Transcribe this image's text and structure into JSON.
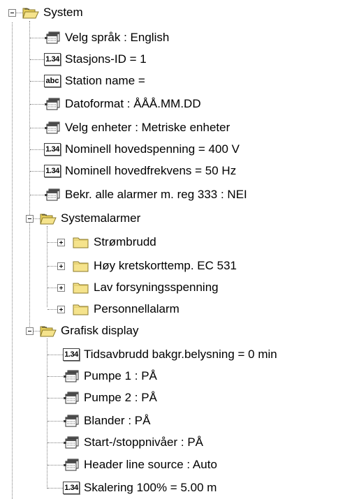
{
  "tree": {
    "root": {
      "label": "System",
      "icon": "open-folder-icon",
      "expanded": true,
      "items": [
        {
          "icon": "list-option-icon",
          "label": "Velg språk : English"
        },
        {
          "icon": "numeric-value-icon",
          "badge": "1.34",
          "label": "Stasjons-ID = 1"
        },
        {
          "icon": "text-value-icon",
          "badge": "abc",
          "label": "Station name ="
        },
        {
          "icon": "list-option-icon",
          "label": "Datoformat : ÅÅÅ.MM.DD"
        },
        {
          "icon": "list-option-icon",
          "label": "Velg enheter : Metriske enheter"
        },
        {
          "icon": "numeric-value-icon",
          "badge": "1.34",
          "label": "Nominell hovedspenning = 400 V"
        },
        {
          "icon": "numeric-value-icon",
          "badge": "1.34",
          "label": "Nominell hovedfrekvens = 50 Hz"
        },
        {
          "icon": "list-option-icon",
          "label": "Bekr. alle alarmer m. reg 333 : NEI"
        }
      ],
      "groups": [
        {
          "label": "Systemalarmer",
          "icon": "open-folder-icon",
          "expanded": true,
          "children": [
            {
              "icon": "folder-icon",
              "label": "Strømbrudd",
              "expanded": false
            },
            {
              "icon": "folder-icon",
              "label": "Høy kretskorttemp. EC 531",
              "expanded": false
            },
            {
              "icon": "folder-icon",
              "label": "Lav forsyningsspenning",
              "expanded": false
            },
            {
              "icon": "folder-icon",
              "label": "Personnellalarm",
              "expanded": false
            }
          ]
        },
        {
          "label": "Grafisk display",
          "icon": "open-folder-icon",
          "expanded": true,
          "children": [
            {
              "icon": "numeric-value-icon",
              "badge": "1.34",
              "label": "Tidsavbrudd bakgr.belysning = 0 min"
            },
            {
              "icon": "list-option-icon",
              "label": "Pumpe 1 : PÅ"
            },
            {
              "icon": "list-option-icon",
              "label": "Pumpe 2 : PÅ"
            },
            {
              "icon": "list-option-icon",
              "label": "Blander : PÅ"
            },
            {
              "icon": "list-option-icon",
              "label": "Start-/stoppnivåer : PÅ"
            },
            {
              "icon": "list-option-icon",
              "label": "Header line source : Auto"
            },
            {
              "icon": "numeric-value-icon",
              "badge": "1.34",
              "label": "Skalering 100% = 5.00 m"
            }
          ]
        }
      ]
    }
  },
  "colors": {
    "folder_fill": "#f5e38c",
    "folder_edge": "#8a7a2a",
    "folder_tab": "#e8cf5a",
    "tree_lines": "#808080",
    "text": "#000000",
    "background": "#ffffff"
  }
}
